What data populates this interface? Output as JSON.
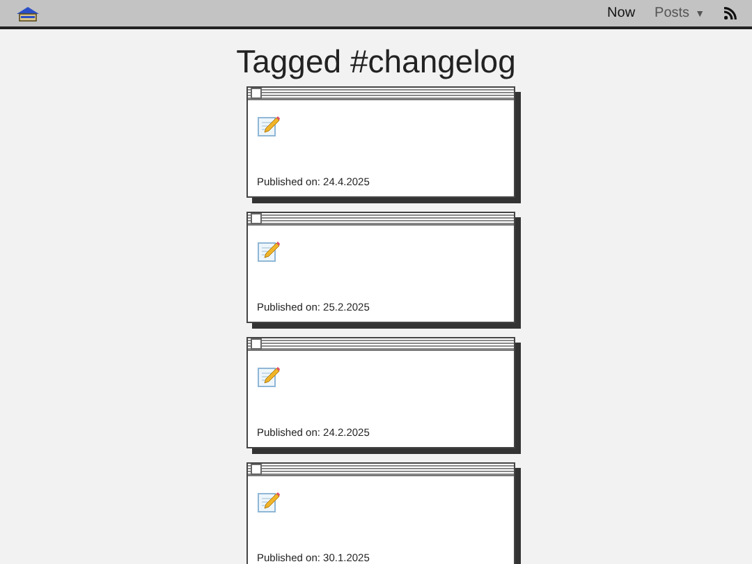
{
  "nav": {
    "links": [
      {
        "label": "Now",
        "selected": true
      },
      {
        "label": "Posts",
        "selected": false,
        "dropdown": "▼"
      }
    ]
  },
  "heading": "Tagged #changelog",
  "posts": [
    {
      "published": "Published on: 24.4.2025"
    },
    {
      "published": "Published on: 25.2.2025"
    },
    {
      "published": "Published on: 24.2.2025"
    },
    {
      "published": "Published on: 30.1.2025"
    }
  ]
}
